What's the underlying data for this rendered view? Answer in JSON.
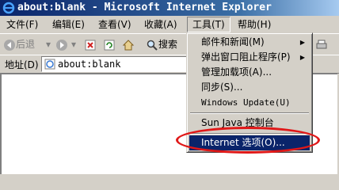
{
  "window": {
    "title": "about:blank - Microsoft Internet Explorer"
  },
  "menubar": {
    "items": [
      {
        "label": "文件(F)"
      },
      {
        "label": "编辑(E)"
      },
      {
        "label": "查看(V)"
      },
      {
        "label": "收藏(A)"
      },
      {
        "label": "工具(T)"
      },
      {
        "label": "帮助(H)"
      }
    ]
  },
  "toolbar": {
    "back_label": "后退",
    "search_label": "搜索"
  },
  "addressbar": {
    "label": "地址(D)",
    "url": "about:blank"
  },
  "tools_menu": {
    "items": [
      {
        "label": "邮件和新闻(M)"
      },
      {
        "label": "弹出窗口阻止程序(P)"
      },
      {
        "label": "管理加载项(A)..."
      },
      {
        "label": "同步(S)..."
      },
      {
        "label": "Windows Update(U)"
      },
      {
        "label": "Sun Java 控制台"
      },
      {
        "label": "Internet 选项(O)..."
      }
    ],
    "highlighted_index": 6
  },
  "colors": {
    "highlight": "#0a246a",
    "annotation_oval": "#e01818",
    "titlebar": "#0a246a"
  }
}
